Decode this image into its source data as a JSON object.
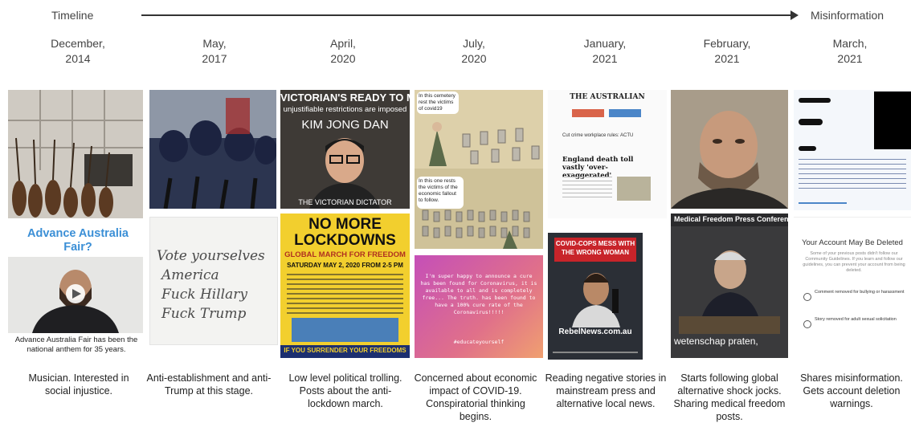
{
  "timeline": {
    "start_label": "Timeline",
    "end_label": "Misinformation"
  },
  "columns": [
    {
      "month": "December,",
      "year": "2014",
      "caption": "Musician. Interested in social injustice."
    },
    {
      "month": "May,",
      "year": "2017",
      "caption": "Anti-establishment and anti-Trump at this stage."
    },
    {
      "month": "April,",
      "year": "2020",
      "caption": "Low level political trolling. Posts about the anti-lockdown march."
    },
    {
      "month": "July,",
      "year": "2020",
      "caption": "Concerned about economic impact of COVID-19. Conspiratorial thinking begins."
    },
    {
      "month": "January,",
      "year": "2021",
      "caption": "Reading negative stories in mainstream press and alternative local news."
    },
    {
      "month": "February,",
      "year": "2021",
      "caption": "Starts following global alternative shock jocks. Sharing medical freedom posts."
    },
    {
      "month": "March,",
      "year": "2021",
      "caption": "Shares misinformation. Gets account deletion warnings."
    }
  ],
  "images": {
    "anthem_title": "Advance Australia Fair?",
    "anthem_caption": "Advance Australia Fair has been the national anthem for 35 years.",
    "handwritten_lines": [
      "Vote yourselves",
      "America",
      "Fuck Hillary",
      "Fuck Trump"
    ],
    "kim_banner": "VICTORIAN'S READY TO M",
    "kim_subtitle": "unjustifiable restrictions are imposed",
    "kim_name": "KIM JONG DAN",
    "kim_bottom": "THE VICTORIAN DICTATOR",
    "poster_title_1": "NO MORE",
    "poster_title_2": "LOCKDOWNS",
    "poster_sub": "GLOBAL MARCH FOR FREEDOM",
    "poster_date": "SATURDAY MAY 2, 2020 FROM 2-5 PM",
    "poster_bottom": "IF YOU SURRENDER YOUR FREEDOMS",
    "cartoon_top": "In this cemetery rest the victims of covid19",
    "cartoon_bottom": "In this one rests the victims of the economic fallout to follow.",
    "cure_post": "I'm super happy to announce a cure has been found for Coronavirus, it is available to all and is completely free... The truth. has been found to have a 100% cure rate of the Coronavirus!!!!!",
    "cure_tag": "#educateyourself",
    "news_masthead": "THE AUSTRALIAN",
    "news_headline": "England death toll vastly 'over-exaggerated'",
    "news_small": "Cut crime workplace rules: ACTU",
    "video_headline": "COVID-COPS MESS WITH THE WRONG WOMAN",
    "video_brand": "RebelNews.com.au",
    "press_banner": "Medical Freedom Press Conferen",
    "press_subtitle": "wetenschap praten,",
    "account_title": "Your Account May Be Deleted",
    "account_body": "Some of your previous posts didn't follow our Community Guidelines. If you learn and follow our guidelines, you can prevent your account from being deleted.",
    "account_item_1": "Comment removed for bullying or harassment",
    "account_item_2": "Story removed for adult sexual solicitation"
  }
}
